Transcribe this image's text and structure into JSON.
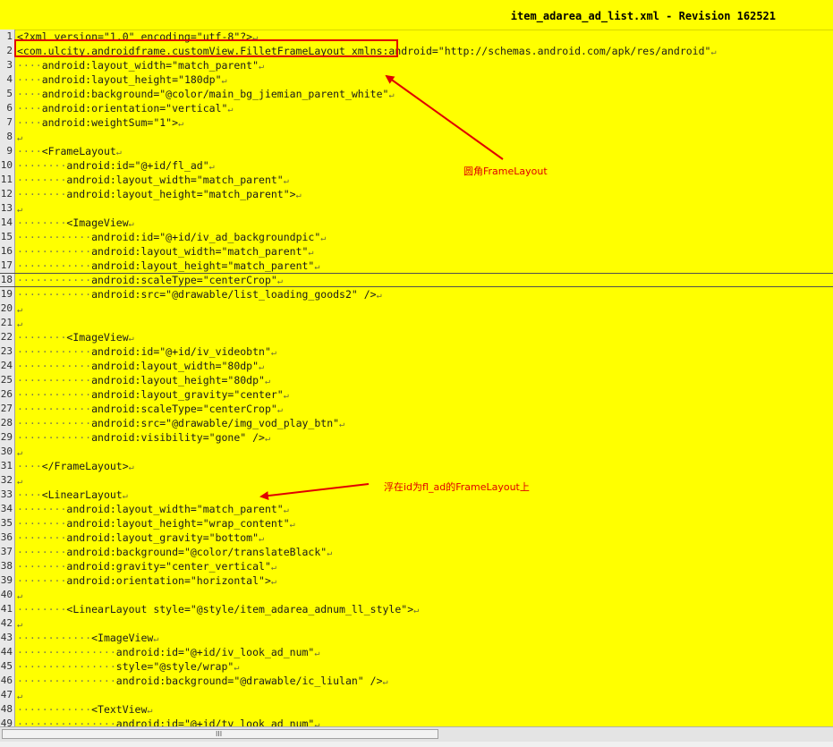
{
  "window": {
    "title": "item_adarea_ad_list.xml - Revision 162521"
  },
  "editor": {
    "lines": [
      {
        "n": "1",
        "i": 0,
        "t": "<?xml version=\"1.0\" encoding=\"utf-8\"?>"
      },
      {
        "n": "2",
        "i": 0,
        "t": "<com.ulcity.androidframe.customView.FilletFrameLayout xmlns:android=\"http://schemas.android.com/apk/res/android\""
      },
      {
        "n": "3",
        "i": 4,
        "t": "android:layout_width=\"match_parent\""
      },
      {
        "n": "4",
        "i": 4,
        "t": "android:layout_height=\"180dp\""
      },
      {
        "n": "5",
        "i": 4,
        "t": "android:background=\"@color/main_bg_jiemian_parent_white\""
      },
      {
        "n": "6",
        "i": 4,
        "t": "android:orientation=\"vertical\""
      },
      {
        "n": "7",
        "i": 4,
        "t": "android:weightSum=\"1\">"
      },
      {
        "n": "8",
        "i": 0,
        "t": ""
      },
      {
        "n": "9",
        "i": 4,
        "t": "<FrameLayout"
      },
      {
        "n": "10",
        "i": 8,
        "t": "android:id=\"@+id/fl_ad\""
      },
      {
        "n": "11",
        "i": 8,
        "t": "android:layout_width=\"match_parent\""
      },
      {
        "n": "12",
        "i": 8,
        "t": "android:layout_height=\"match_parent\">"
      },
      {
        "n": "13",
        "i": 0,
        "t": ""
      },
      {
        "n": "14",
        "i": 8,
        "t": "<ImageView"
      },
      {
        "n": "15",
        "i": 12,
        "t": "android:id=\"@+id/iv_ad_backgroundpic\""
      },
      {
        "n": "16",
        "i": 12,
        "t": "android:layout_width=\"match_parent\""
      },
      {
        "n": "17",
        "i": 12,
        "t": "android:layout_height=\"match_parent\""
      },
      {
        "n": "18",
        "i": 12,
        "t": "android:scaleType=\"centerCrop\""
      },
      {
        "n": "19",
        "i": 12,
        "t": "android:src=\"@drawable/list_loading_goods2\" />"
      },
      {
        "n": "20",
        "i": 0,
        "t": ""
      },
      {
        "n": "21",
        "i": 0,
        "t": ""
      },
      {
        "n": "22",
        "i": 8,
        "t": "<ImageView"
      },
      {
        "n": "23",
        "i": 12,
        "t": "android:id=\"@+id/iv_videobtn\""
      },
      {
        "n": "24",
        "i": 12,
        "t": "android:layout_width=\"80dp\""
      },
      {
        "n": "25",
        "i": 12,
        "t": "android:layout_height=\"80dp\""
      },
      {
        "n": "26",
        "i": 12,
        "t": "android:layout_gravity=\"center\""
      },
      {
        "n": "27",
        "i": 12,
        "t": "android:scaleType=\"centerCrop\""
      },
      {
        "n": "28",
        "i": 12,
        "t": "android:src=\"@drawable/img_vod_play_btn\""
      },
      {
        "n": "29",
        "i": 12,
        "t": "android:visibility=\"gone\" />"
      },
      {
        "n": "30",
        "i": 0,
        "t": ""
      },
      {
        "n": "31",
        "i": 4,
        "t": "</FrameLayout>"
      },
      {
        "n": "32",
        "i": 0,
        "t": ""
      },
      {
        "n": "33",
        "i": 4,
        "t": "<LinearLayout"
      },
      {
        "n": "34",
        "i": 8,
        "t": "android:layout_width=\"match_parent\""
      },
      {
        "n": "35",
        "i": 8,
        "t": "android:layout_height=\"wrap_content\""
      },
      {
        "n": "36",
        "i": 8,
        "t": "android:layout_gravity=\"bottom\""
      },
      {
        "n": "37",
        "i": 8,
        "t": "android:background=\"@color/translateBlack\""
      },
      {
        "n": "38",
        "i": 8,
        "t": "android:gravity=\"center_vertical\""
      },
      {
        "n": "39",
        "i": 8,
        "t": "android:orientation=\"horizontal\">"
      },
      {
        "n": "40",
        "i": 0,
        "t": ""
      },
      {
        "n": "41",
        "i": 8,
        "t": "<LinearLayout style=\"@style/item_adarea_adnum_ll_style\">"
      },
      {
        "n": "42",
        "i": 0,
        "t": ""
      },
      {
        "n": "43",
        "i": 12,
        "t": "<ImageView"
      },
      {
        "n": "44",
        "i": 16,
        "t": "android:id=\"@+id/iv_look_ad_num\""
      },
      {
        "n": "45",
        "i": 16,
        "t": "style=\"@style/wrap\""
      },
      {
        "n": "46",
        "i": 16,
        "t": "android:background=\"@drawable/ic_liulan\" />"
      },
      {
        "n": "47",
        "i": 0,
        "t": ""
      },
      {
        "n": "48",
        "i": 12,
        "t": "<TextView"
      },
      {
        "n": "49",
        "i": 16,
        "t": "android:id=\"@+id/tv_look_ad_num\""
      }
    ],
    "current_line": "18",
    "newline_glyph": "↵",
    "space_glyph": "·"
  },
  "annotations": {
    "rounded_frame": "圆角FrameLayout",
    "floating": "浮在id为fl_ad的FrameLayout上",
    "color": "#e00000"
  },
  "scrollbar": {
    "grip": "III"
  }
}
